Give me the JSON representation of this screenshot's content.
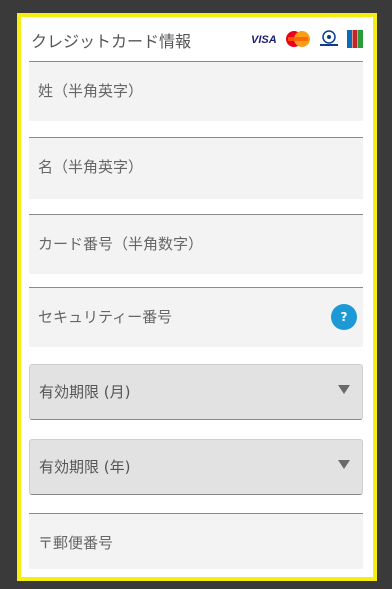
{
  "header": {
    "title": "クレジットカード情報",
    "brands": [
      {
        "name": "visa-logo",
        "text": "VISA"
      },
      {
        "name": "mastercard-logo",
        "text": "MasterCard"
      },
      {
        "name": "diners-club-logo",
        "text": "Diners Club"
      },
      {
        "name": "jcb-logo",
        "text": "JCB"
      }
    ]
  },
  "form": {
    "last_name_placeholder": "姓（半角英字）",
    "first_name_placeholder": "名（半角英字）",
    "card_number_placeholder": "カード番号（半角数字）",
    "security_code_placeholder": "セキュリティー番号",
    "help_icon": "?",
    "expiry_month_label": "有効期限 (月)",
    "expiry_year_label": "有効期限 (年)",
    "postal_code_placeholder": "〒郵便番号"
  }
}
